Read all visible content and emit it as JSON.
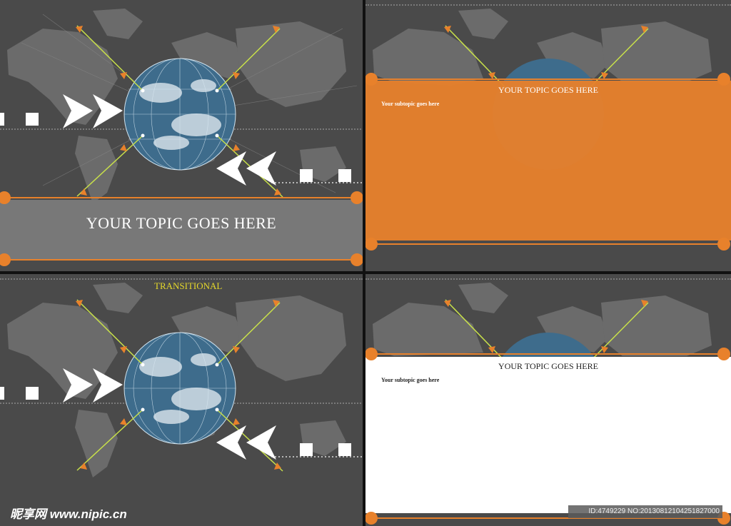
{
  "slide1": {
    "topic": "YOUR TOPIC GOES HERE"
  },
  "slide2": {
    "topic": "YOUR TOPIC GOES HERE",
    "subtopic": "Your subtopic goes here"
  },
  "slide3": {
    "title": "TRANSITIONAL"
  },
  "slide4": {
    "topic": "YOUR TOPIC GOES HERE",
    "subtopic": "Your subtopic goes here"
  },
  "watermark": {
    "site": "昵享网 www.nipic.cn",
    "id": "ID:4749229 NO:20130812104251827000"
  },
  "colors": {
    "background": "#4a4a4a",
    "map": "#6e6e6e",
    "orange": "#e8812b",
    "accent_line": "#c8e04a",
    "title_yellow": "#e6d92a"
  }
}
